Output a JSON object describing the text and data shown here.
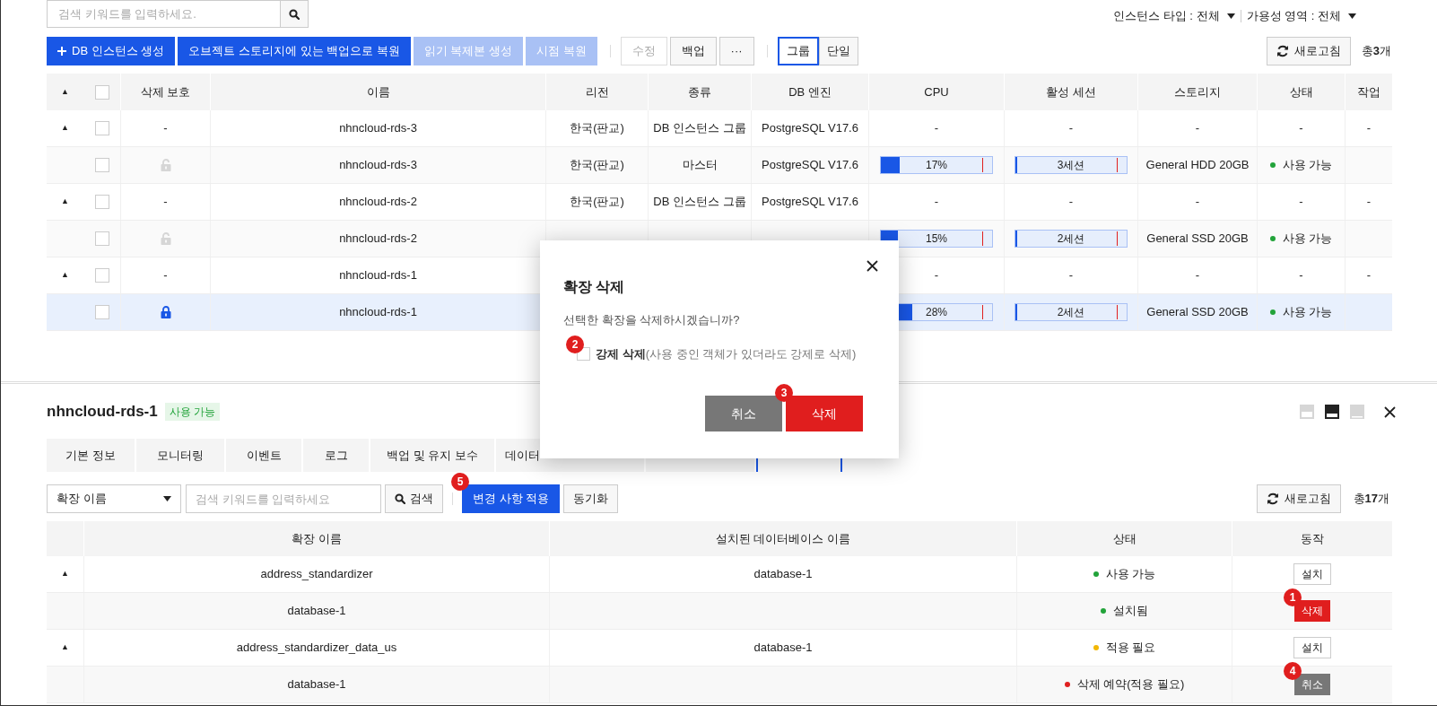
{
  "search": {
    "placeholder": "검색 키워드를 입력하세요."
  },
  "filters": [
    {
      "label": "인스턴스 타입 : 전체"
    },
    {
      "label": "가용성 영역 : 전체"
    }
  ],
  "toolbar": [
    {
      "label": "DB 인스턴스 생성",
      "kind": "create",
      "disabled": false
    },
    {
      "label": "오브젝트 스토리지에 있는 백업으로 복원",
      "kind": "primary",
      "disabled": false
    },
    {
      "label": "읽기 복제본 생성",
      "kind": "primary",
      "disabled": true
    },
    {
      "label": "시점 복원",
      "kind": "primary",
      "disabled": true
    },
    {
      "kind": "separator"
    },
    {
      "label": "수정",
      "kind": "default",
      "disabled": true
    },
    {
      "label": "백업",
      "kind": "default",
      "disabled": false
    },
    {
      "label": "···",
      "kind": "default",
      "disabled": false
    },
    {
      "kind": "separator"
    }
  ],
  "view_toggle": [
    {
      "label": "그룹",
      "selected": true
    },
    {
      "label": "단일",
      "selected": false
    }
  ],
  "refresh": "새로고침",
  "total": {
    "prefix": "총",
    "count": "3",
    "suffix": "개"
  },
  "table": {
    "select_all": false,
    "columns": [
      "▲",
      "삭제 보호",
      "이름",
      "리전",
      "종류",
      "DB 엔진",
      "CPU",
      "활성 세션",
      "스토리지",
      "상태",
      "작업"
    ],
    "rows": [
      {
        "kind": "group",
        "expander": "▲",
        "protection": "-",
        "name": "nhncloud-rds-3",
        "region": "한국(판교)",
        "type": "DB 인스턴스 그룹",
        "engine": "PostgreSQL V17.6",
        "cpu": "-",
        "sessions": "-",
        "storage": "-",
        "status": "-",
        "action": "-",
        "selected": false
      },
      {
        "kind": "instance",
        "locked": false,
        "name": "nhncloud-rds-3",
        "region": "한국(판교)",
        "type": "마스터",
        "engine": "PostgreSQL V17.6",
        "cpu": {
          "level": 0.17,
          "reading": "17%"
        },
        "sessions": {
          "level": 0.02,
          "reading": "3세션"
        },
        "storage": "General HDD 20GB",
        "status": {
          "label": "사용 가능",
          "color": "#22a33a"
        },
        "selected": false
      },
      {
        "kind": "group",
        "expander": "▲",
        "protection": "-",
        "name": "nhncloud-rds-2",
        "region": "한국(판교)",
        "type": "DB 인스턴스 그룹",
        "engine": "PostgreSQL V17.6",
        "cpu": "-",
        "sessions": "-",
        "storage": "-",
        "status": "-",
        "action": "-",
        "selected": false
      },
      {
        "kind": "instance",
        "locked": false,
        "name": "nhncloud-rds-2",
        "cpu": {
          "level": 0.15,
          "reading": "15%"
        },
        "sessions": {
          "level": 0.02,
          "reading": "2세션"
        },
        "storage": "General SSD 20GB",
        "status": {
          "label": "사용 가능",
          "color": "#22a33a"
        },
        "selected": false
      },
      {
        "kind": "group",
        "expander": "▲",
        "protection": "-",
        "name": "nhncloud-rds-1",
        "cpu": "-",
        "sessions": "-",
        "storage": "-",
        "status": "-",
        "action": "-",
        "selected": false
      },
      {
        "kind": "instance",
        "locked": true,
        "name": "nhncloud-rds-1",
        "cpu": {
          "level": 0.28,
          "reading": "28%"
        },
        "sessions": {
          "level": 0.02,
          "reading": "2세션"
        },
        "storage": "General SSD 20GB",
        "status": {
          "label": "사용 가능",
          "color": "#22a33a"
        },
        "selected": true
      }
    ]
  },
  "detail": {
    "title": "nhncloud-rds-1",
    "badge": "사용 가능",
    "layouts": [
      {
        "kind": "top",
        "selected": false
      },
      {
        "kind": "bottom",
        "selected": true
      },
      {
        "kind": "min",
        "selected": false
      }
    ],
    "tabs": [
      {
        "label": "기본 정보",
        "selected": false
      },
      {
        "label": "모니터링",
        "selected": false
      },
      {
        "label": "이벤트",
        "selected": false
      },
      {
        "label": "로그",
        "selected": false
      },
      {
        "label": "백업 및 유지 보수",
        "selected": false
      },
      {
        "label": "데이터",
        "selected": false
      },
      {
        "selected": false
      },
      {
        "selected": true
      }
    ],
    "filter": {
      "field": "확장 이름",
      "placeholder": "검색 키워드를 입력하세요",
      "search": "검색"
    },
    "apply": {
      "label": "변경 사항 적용",
      "marker": "5"
    },
    "sync": "동기화",
    "refresh": "새로고침",
    "total": {
      "prefix": "총",
      "count": "17",
      "suffix": "개"
    },
    "table": {
      "columns": [
        "확장 이름",
        "설치된 데이터베이스 이름",
        "상태",
        "동작"
      ],
      "rows": [
        {
          "kind": "group",
          "expander": "▲",
          "name": "address_standardizer",
          "database": "database-1",
          "status": {
            "label": "사용 가능",
            "color": "#22a33a"
          },
          "action": {
            "label": "설치",
            "kind": "default"
          }
        },
        {
          "kind": "child",
          "name": "database-1",
          "status": {
            "label": "설치됨",
            "color": "#22a33a"
          },
          "action": {
            "label": "삭제",
            "kind": "danger",
            "marker": "1"
          }
        },
        {
          "kind": "group",
          "expander": "▲",
          "name": "address_standardizer_data_us",
          "database": "database-1",
          "status": {
            "label": "적용 필요",
            "color": "#f2b705"
          },
          "action": {
            "label": "설치",
            "kind": "default"
          }
        },
        {
          "kind": "child",
          "name": "database-1",
          "status": {
            "label": "삭제 예약(적용 필요)",
            "color": "#e02020"
          },
          "action": {
            "label": "취소",
            "kind": "muted",
            "marker": "4"
          }
        }
      ]
    }
  },
  "dialog": {
    "title": "확장 삭제",
    "message": "선택한 확장을 삭제하시겠습니까?",
    "option": {
      "label": "강제 삭제",
      "hint": "(사용 중인 객체가 있더라도 강제로 삭제)",
      "checked": false,
      "marker": "2"
    },
    "buttons": [
      {
        "label": "취소",
        "kind": "cancel"
      },
      {
        "label": "삭제",
        "kind": "danger",
        "marker": "3"
      }
    ]
  }
}
